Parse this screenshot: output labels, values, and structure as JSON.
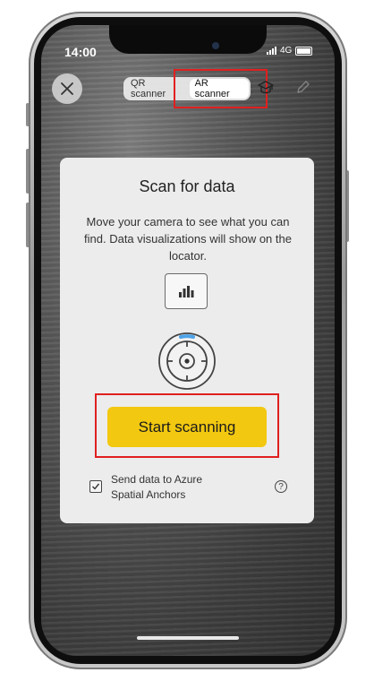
{
  "status_bar": {
    "time": "14:00",
    "network": "4G",
    "icons": [
      "signal-icon",
      "battery-icon"
    ]
  },
  "toolbar": {
    "close_icon": "close-icon",
    "tabs": [
      {
        "label": "QR scanner",
        "active": false
      },
      {
        "label": "AR scanner",
        "active": true
      }
    ],
    "icons": [
      "graduation-cap-icon",
      "pencil-icon"
    ]
  },
  "card": {
    "title": "Scan for data",
    "description": "Move your camera to see what you can find. Data visualizations will show on the locator.",
    "chart_icon": "bar-chart-icon",
    "locator_icon": "locator-icon",
    "start_label": "Start scanning",
    "checkbox_label": "Send data to Azure Spatial Anchors",
    "checkbox_checked": true,
    "help_icon": "help-icon",
    "help_glyph": "?"
  },
  "colors": {
    "accent": "#f2c811",
    "highlight": "#e0201f",
    "card_bg": "#ececec"
  }
}
